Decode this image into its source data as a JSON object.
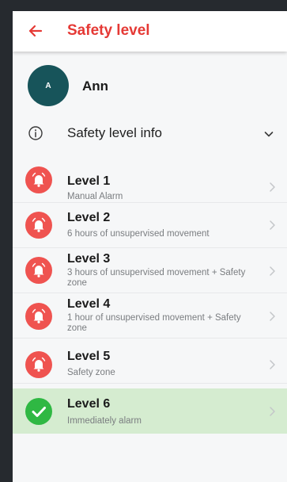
{
  "colors": {
    "accent": "#e53935",
    "alarm": "#ef5350",
    "success": "#2fb843",
    "selected_background": "#d5ecd0",
    "avatar_background": "#17545a"
  },
  "header": {
    "back_icon": "arrow-left-icon",
    "title": "Safety level"
  },
  "profile": {
    "avatar_initial": "A",
    "name": "Ann"
  },
  "info": {
    "icon": "info-icon",
    "label": "Safety level info",
    "expand_icon": "chevron-down-icon"
  },
  "levels": [
    {
      "title": "Level 1",
      "description": "Manual Alarm",
      "status": "alarm",
      "icon": "bell-icon",
      "selected": false
    },
    {
      "title": "Level 2",
      "description": "6 hours of unsupervised movement",
      "status": "alarm",
      "icon": "bell-icon",
      "selected": false
    },
    {
      "title": "Level 3",
      "description": "3 hours of unsupervised movement + Safety zone",
      "status": "alarm",
      "icon": "bell-icon",
      "selected": false
    },
    {
      "title": "Level 4",
      "description": "1 hour of unsupervised movement + Safety zone",
      "status": "alarm",
      "icon": "bell-icon",
      "selected": false
    },
    {
      "title": "Level 5",
      "description": "Safety zone",
      "status": "alarm",
      "icon": "bell-icon",
      "selected": false
    },
    {
      "title": "Level 6",
      "description": "Immediately alarm",
      "status": "selected",
      "icon": "check-icon",
      "selected": true
    }
  ]
}
